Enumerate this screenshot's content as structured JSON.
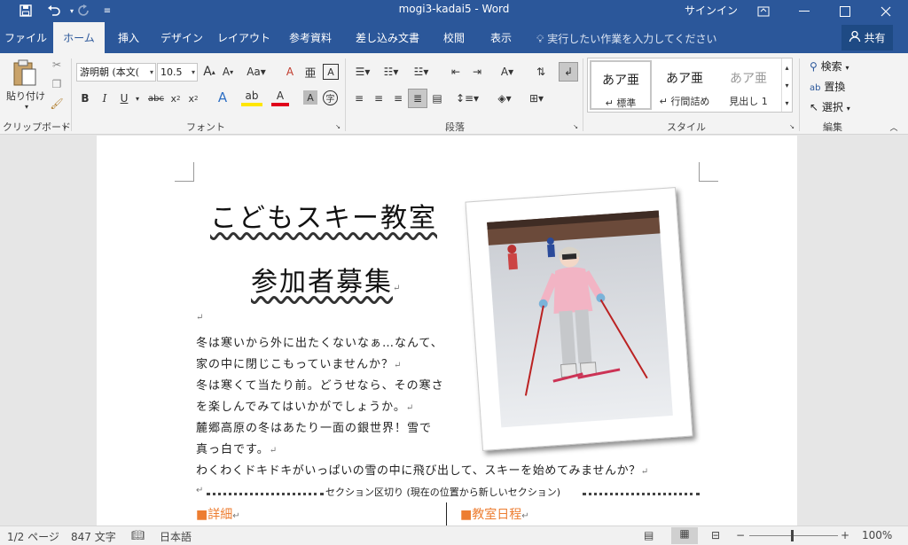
{
  "window": {
    "title": "mogi3-kadai5  -  Word",
    "signin": "サインイン",
    "controls": [
      "restore-ribbon",
      "minimize",
      "maximize",
      "close"
    ]
  },
  "quick_access": {
    "save_icon": "save-icon",
    "undo_icon": "undo-icon",
    "redo_icon": "redo-icon"
  },
  "tabs": [
    {
      "label": "ファイル"
    },
    {
      "label": "ホーム",
      "active": true
    },
    {
      "label": "挿入"
    },
    {
      "label": "デザイン"
    },
    {
      "label": "レイアウト"
    },
    {
      "label": "参考資料"
    },
    {
      "label": "差し込み文書"
    },
    {
      "label": "校閲"
    },
    {
      "label": "表示"
    }
  ],
  "tell_me": "実行したい作業を入力してください",
  "share": "共有",
  "ribbon": {
    "clipboard": {
      "paste": "貼り付け",
      "label": "クリップボード"
    },
    "font": {
      "name": "游明朝 (本文(",
      "size": "10.5",
      "label": "フォント"
    },
    "paragraph": {
      "label": "段落"
    },
    "styles": {
      "label": "スタイル",
      "items": [
        {
          "preview": "あア亜",
          "name": "↵ 標準"
        },
        {
          "preview": "あア亜",
          "name": "↵ 行間詰め"
        },
        {
          "preview": "あア亜",
          "name": "見出し 1"
        }
      ]
    },
    "editing": {
      "find": "検索",
      "replace": "置換",
      "select": "選択",
      "label": "編集"
    }
  },
  "document": {
    "title1": "こどもスキー教室",
    "title2": "参加者募集",
    "lines": [
      "冬は寒いから外に出たくないなぁ…なんて、",
      "家の中に閉じこもっていませんか？",
      "冬は寒くて当たり前。どうせなら、その寒さ",
      "を楽しんでみてはいかがでしょうか。",
      "麓郷高原の冬はあたり一面の銀世界！雪で",
      "真っ白です。",
      "わくわくドキドキがいっぱいの雪の中に飛び出して、スキーを始めてみませんか？"
    ],
    "section_break": "セクション区切り (現在の位置から新しいセクション)",
    "heading_left": "■詳細",
    "heading_right": "■教室日程"
  },
  "status": {
    "page": "1/2 ページ",
    "words": "847 文字",
    "lang": "日本語",
    "zoom": "100%",
    "zoom_level": 1.0
  },
  "colors": {
    "accent": "#2b579a",
    "heading_orange": "#ed7d31"
  }
}
